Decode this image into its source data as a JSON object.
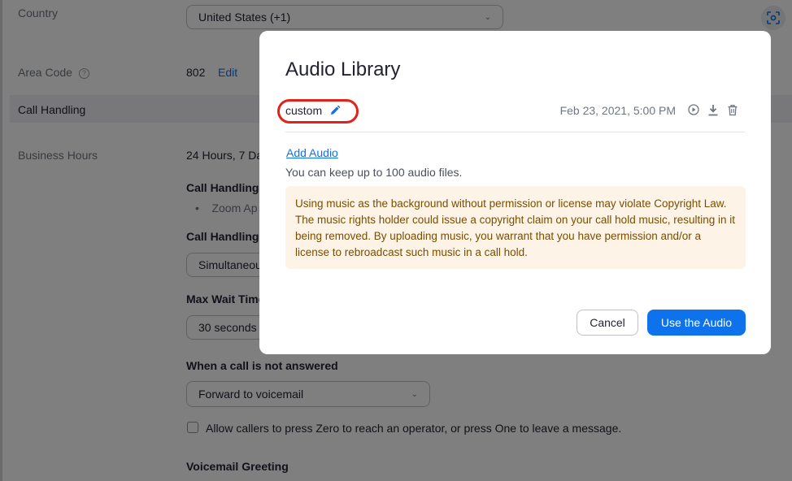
{
  "background": {
    "country_label": "Country",
    "country_value": "United States (+1)",
    "area_code_label": "Area Code",
    "area_code_value": "802",
    "area_code_edit": "Edit",
    "call_handling_section": "Call Handling",
    "business_hours_label": "Business Hours",
    "business_hours_value": "24 Hours, 7 Da",
    "call_handling_sub": "Call Handling",
    "zoom_app_item": "Zoom Ap",
    "call_handling_f": "Call Handling F",
    "simultaneous_value": "Simultaneou",
    "max_wait_label": "Max Wait Time",
    "max_wait_value": "30 seconds",
    "not_answered_label": "When a call is not answered",
    "not_answered_value": "Forward to voicemail",
    "press_zero_text": "Allow callers to press Zero to reach an operator, or press One to leave a message.",
    "voicemail_greeting": "Voicemail Greeting"
  },
  "modal": {
    "title": "Audio Library",
    "audio_item": {
      "name": "custom",
      "date": "Feb 23, 2021, 5:00 PM"
    },
    "add_audio_link": "Add Audio",
    "keep_text": "You can keep up to 100 audio files.",
    "warning_text": "Using music as the background without permission or license may violate Copyright Law. The music rights holder could issue a copyright claim on your call hold music, resulting in it being removed. By uploading music, you warrant that you have permission and/or a license to rebroadcast such music in a call hold.",
    "cancel_label": "Cancel",
    "use_label": "Use the Audio"
  },
  "colors": {
    "accent": "#0e72ed",
    "highlight_ring": "#e0221a",
    "warning_bg": "#fdf4e7",
    "warning_text": "#7a4d00"
  }
}
